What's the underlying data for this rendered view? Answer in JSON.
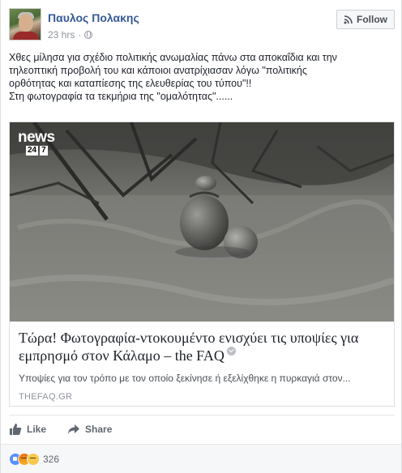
{
  "post": {
    "author": "Παυλος Πολακης",
    "timestamp": "23 hrs",
    "separator": "·",
    "follow_label": "Follow",
    "text_lines": [
      "Χθες μίλησα για σχέδιο πολιτικής ανωμαλίας πάνω στα αποκαΐδια και την",
      "τηλεοπτική προβολή του και κάποιοι ανατρίχιασαν λόγω \"πολιτικής",
      "ορθότητας και καταπίεσης της ελευθερίας του τύπου\"!!",
      "Στη φωτογραφία τα τεκμήρια της \"ομαλότητας\"......"
    ]
  },
  "link": {
    "logo_text": "news",
    "logo_24": "24",
    "logo_7": "7",
    "title": "Τώρα! Φωτογραφία-ντοκουμέντο ενισχύει τις υποψίες για εμπρησμό στον Κάλαμο – the FAQ",
    "description": "Υποψίες για τον τρόπο με τον οποίο ξεκίνησε ή εξελίχθηκε η πυρκαγιά στον...",
    "domain": "THEFAQ.GR"
  },
  "actions": {
    "like_label": "Like",
    "share_label": "Share"
  },
  "reactions": {
    "count": "326"
  },
  "colors": {
    "link_blue": "#365899",
    "facebook_blue": "#5890ff",
    "muted_text": "#90949c"
  }
}
